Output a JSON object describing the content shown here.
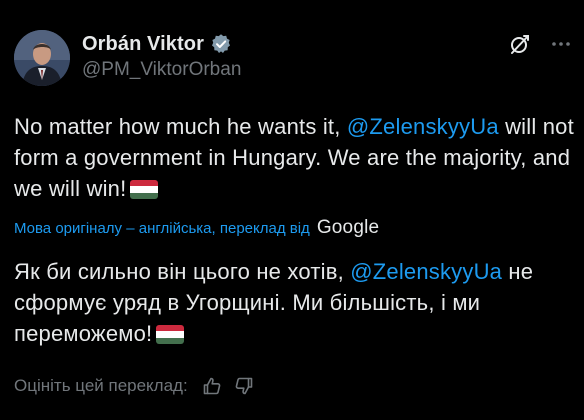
{
  "author": {
    "display_name": "Orbán Viktor",
    "handle": "@PM_ViktorOrban"
  },
  "icons": {
    "verified": "verified-badge-icon",
    "grok": "grok-icon",
    "more": "more-options-icon",
    "thumbs_up": "thumbs-up-icon",
    "thumbs_down": "thumbs-down-icon",
    "flag": "hungary-flag-emoji"
  },
  "post": {
    "original": {
      "part1": "No matter how much he wants it, ",
      "mention": "@ZelenskyyUa",
      "part2": " will not form a government in Hungary. We are the majority, and we will win!"
    },
    "translation_note": "Мова оригіналу – англійська, переклад від",
    "translation_provider": "Google",
    "translated": {
      "part1": "Як би сильно він цього не хотів, ",
      "mention": "@ZelenskyyUa",
      "part2": " не сформує уряд в Угорщині. Ми більшість, і ми переможемо!"
    },
    "rate_prompt": "Оцініть цей переклад:"
  },
  "colors": {
    "background": "#000000",
    "text": "#e7e9ea",
    "secondary": "#71767b",
    "link": "#1d9bf0",
    "flag_red": "#cd2a3e",
    "flag_white": "#ffffff",
    "flag_green": "#436f4d"
  }
}
